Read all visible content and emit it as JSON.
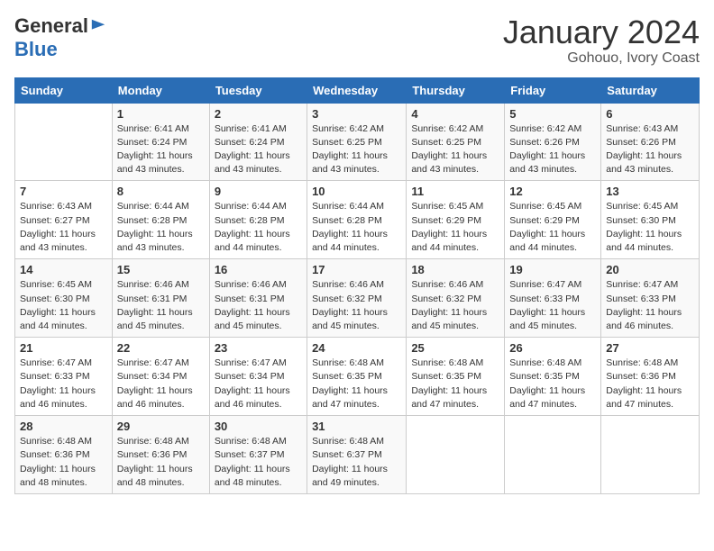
{
  "header": {
    "logo_general": "General",
    "logo_blue": "Blue",
    "month": "January 2024",
    "location": "Gohouo, Ivory Coast"
  },
  "days_of_week": [
    "Sunday",
    "Monday",
    "Tuesday",
    "Wednesday",
    "Thursday",
    "Friday",
    "Saturday"
  ],
  "weeks": [
    [
      {
        "day": "",
        "info": ""
      },
      {
        "day": "1",
        "info": "Sunrise: 6:41 AM\nSunset: 6:24 PM\nDaylight: 11 hours and 43 minutes."
      },
      {
        "day": "2",
        "info": "Sunrise: 6:41 AM\nSunset: 6:24 PM\nDaylight: 11 hours and 43 minutes."
      },
      {
        "day": "3",
        "info": "Sunrise: 6:42 AM\nSunset: 6:25 PM\nDaylight: 11 hours and 43 minutes."
      },
      {
        "day": "4",
        "info": "Sunrise: 6:42 AM\nSunset: 6:25 PM\nDaylight: 11 hours and 43 minutes."
      },
      {
        "day": "5",
        "info": "Sunrise: 6:42 AM\nSunset: 6:26 PM\nDaylight: 11 hours and 43 minutes."
      },
      {
        "day": "6",
        "info": "Sunrise: 6:43 AM\nSunset: 6:26 PM\nDaylight: 11 hours and 43 minutes."
      }
    ],
    [
      {
        "day": "7",
        "info": "Sunrise: 6:43 AM\nSunset: 6:27 PM\nDaylight: 11 hours and 43 minutes."
      },
      {
        "day": "8",
        "info": "Sunrise: 6:44 AM\nSunset: 6:28 PM\nDaylight: 11 hours and 43 minutes."
      },
      {
        "day": "9",
        "info": "Sunrise: 6:44 AM\nSunset: 6:28 PM\nDaylight: 11 hours and 44 minutes."
      },
      {
        "day": "10",
        "info": "Sunrise: 6:44 AM\nSunset: 6:28 PM\nDaylight: 11 hours and 44 minutes."
      },
      {
        "day": "11",
        "info": "Sunrise: 6:45 AM\nSunset: 6:29 PM\nDaylight: 11 hours and 44 minutes."
      },
      {
        "day": "12",
        "info": "Sunrise: 6:45 AM\nSunset: 6:29 PM\nDaylight: 11 hours and 44 minutes."
      },
      {
        "day": "13",
        "info": "Sunrise: 6:45 AM\nSunset: 6:30 PM\nDaylight: 11 hours and 44 minutes."
      }
    ],
    [
      {
        "day": "14",
        "info": "Sunrise: 6:45 AM\nSunset: 6:30 PM\nDaylight: 11 hours and 44 minutes."
      },
      {
        "day": "15",
        "info": "Sunrise: 6:46 AM\nSunset: 6:31 PM\nDaylight: 11 hours and 45 minutes."
      },
      {
        "day": "16",
        "info": "Sunrise: 6:46 AM\nSunset: 6:31 PM\nDaylight: 11 hours and 45 minutes."
      },
      {
        "day": "17",
        "info": "Sunrise: 6:46 AM\nSunset: 6:32 PM\nDaylight: 11 hours and 45 minutes."
      },
      {
        "day": "18",
        "info": "Sunrise: 6:46 AM\nSunset: 6:32 PM\nDaylight: 11 hours and 45 minutes."
      },
      {
        "day": "19",
        "info": "Sunrise: 6:47 AM\nSunset: 6:33 PM\nDaylight: 11 hours and 45 minutes."
      },
      {
        "day": "20",
        "info": "Sunrise: 6:47 AM\nSunset: 6:33 PM\nDaylight: 11 hours and 46 minutes."
      }
    ],
    [
      {
        "day": "21",
        "info": "Sunrise: 6:47 AM\nSunset: 6:33 PM\nDaylight: 11 hours and 46 minutes."
      },
      {
        "day": "22",
        "info": "Sunrise: 6:47 AM\nSunset: 6:34 PM\nDaylight: 11 hours and 46 minutes."
      },
      {
        "day": "23",
        "info": "Sunrise: 6:47 AM\nSunset: 6:34 PM\nDaylight: 11 hours and 46 minutes."
      },
      {
        "day": "24",
        "info": "Sunrise: 6:48 AM\nSunset: 6:35 PM\nDaylight: 11 hours and 47 minutes."
      },
      {
        "day": "25",
        "info": "Sunrise: 6:48 AM\nSunset: 6:35 PM\nDaylight: 11 hours and 47 minutes."
      },
      {
        "day": "26",
        "info": "Sunrise: 6:48 AM\nSunset: 6:35 PM\nDaylight: 11 hours and 47 minutes."
      },
      {
        "day": "27",
        "info": "Sunrise: 6:48 AM\nSunset: 6:36 PM\nDaylight: 11 hours and 47 minutes."
      }
    ],
    [
      {
        "day": "28",
        "info": "Sunrise: 6:48 AM\nSunset: 6:36 PM\nDaylight: 11 hours and 48 minutes."
      },
      {
        "day": "29",
        "info": "Sunrise: 6:48 AM\nSunset: 6:36 PM\nDaylight: 11 hours and 48 minutes."
      },
      {
        "day": "30",
        "info": "Sunrise: 6:48 AM\nSunset: 6:37 PM\nDaylight: 11 hours and 48 minutes."
      },
      {
        "day": "31",
        "info": "Sunrise: 6:48 AM\nSunset: 6:37 PM\nDaylight: 11 hours and 49 minutes."
      },
      {
        "day": "",
        "info": ""
      },
      {
        "day": "",
        "info": ""
      },
      {
        "day": "",
        "info": ""
      }
    ]
  ]
}
